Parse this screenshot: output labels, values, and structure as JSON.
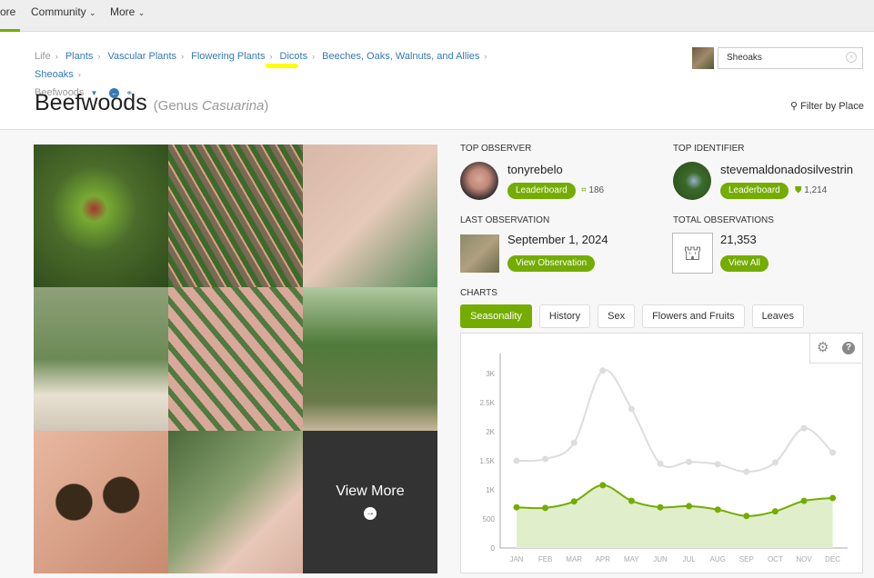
{
  "nav": {
    "items": [
      "ore",
      "Community",
      "More"
    ]
  },
  "breadcrumb": {
    "items": [
      "Life",
      "Plants",
      "Vascular Plants",
      "Flowering Plants",
      "Dicots",
      "Beeches, Oaks, Walnuts, and Allies",
      "Sheoaks"
    ],
    "current": "Beefwoods"
  },
  "title": {
    "common": "Beefwoods",
    "rank": "(Genus ",
    "scientific": "Casuarina",
    "close": ")"
  },
  "search": {
    "value": "Sheoaks"
  },
  "filter_label": "Filter by Place",
  "photos": {
    "view_more": "View More"
  },
  "top_observer": {
    "label": "TOP OBSERVER",
    "name": "tonyrebelo",
    "button": "Leaderboard",
    "count": "186"
  },
  "top_identifier": {
    "label": "TOP IDENTIFIER",
    "name": "stevemaldonadosilvestrin",
    "button": "Leaderboard",
    "count": "1,214"
  },
  "last_observation": {
    "label": "LAST OBSERVATION",
    "date": "September 1, 2024",
    "button": "View Observation"
  },
  "total_observations": {
    "label": "TOTAL OBSERVATIONS",
    "count": "21,353",
    "button": "View All"
  },
  "charts": {
    "label": "CHARTS",
    "tabs": [
      "Seasonality",
      "History",
      "Sex",
      "Flowers and Fruits",
      "Leaves"
    ],
    "active": "Seasonality"
  },
  "colors": {
    "accent": "#74ac00",
    "grey_series": "#dddddd"
  },
  "chart_data": {
    "type": "line",
    "categories": [
      "JAN",
      "FEB",
      "MAR",
      "APR",
      "MAY",
      "JUN",
      "JUL",
      "AUG",
      "SEP",
      "OCT",
      "NOV",
      "DEC"
    ],
    "yticks": [
      "0",
      "500",
      "1K",
      "1.5K",
      "2K",
      "2.5K",
      "3K"
    ],
    "ylim": [
      0,
      3000
    ],
    "series": [
      {
        "color": "#dddddd",
        "values": [
          1500,
          1530,
          1810,
          3050,
          2390,
          1450,
          1480,
          1440,
          1310,
          1470,
          2060,
          1640
        ]
      },
      {
        "color": "#74ac00",
        "fill": "#e1eecc",
        "values": [
          700,
          690,
          800,
          1080,
          810,
          700,
          720,
          660,
          550,
          630,
          810,
          860
        ]
      }
    ]
  }
}
